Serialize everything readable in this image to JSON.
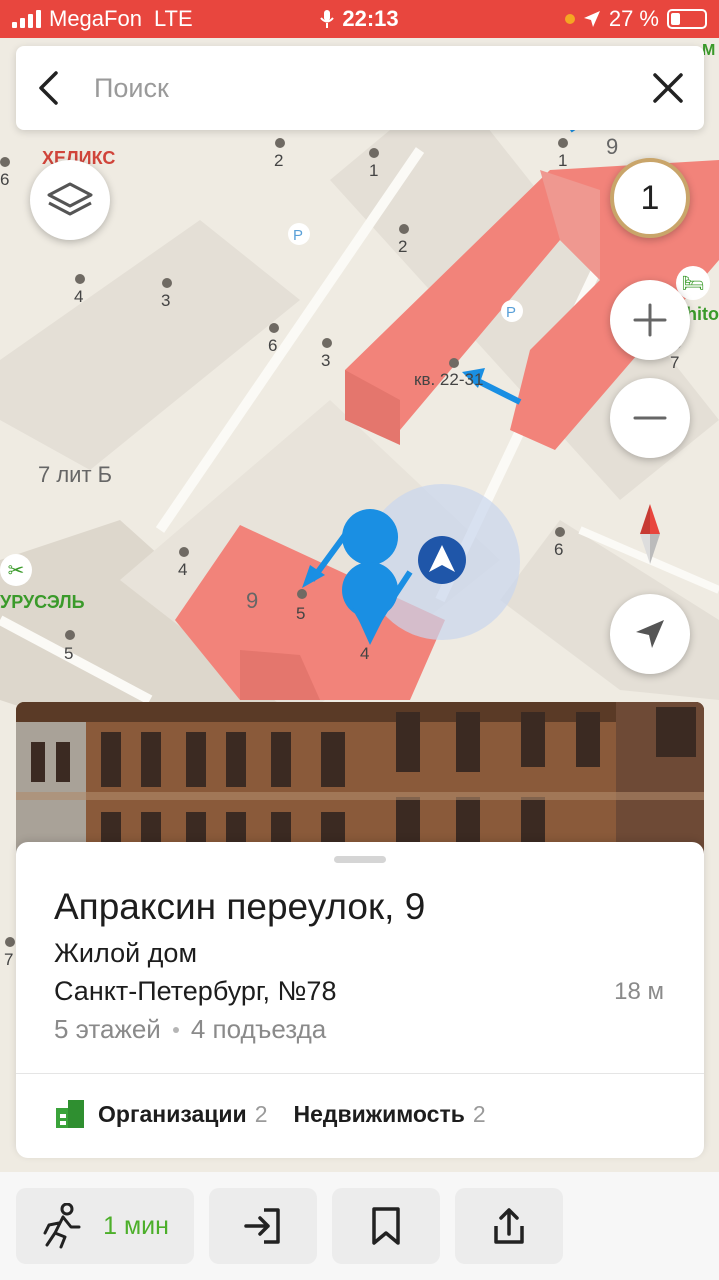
{
  "status_bar": {
    "carrier": "MegaFon",
    "network": "LTE",
    "time": "22:13",
    "battery": "27 %"
  },
  "search": {
    "placeholder": "Поиск"
  },
  "map": {
    "zoom_level": "1",
    "labels": {
      "helix": "ХЕЛИКС",
      "kv": "кв. 22-31",
      "lit": "7 лит Б",
      "urusel": "УРУСЭЛЬ",
      "hito": "hito",
      "m": "M",
      "house_9_top": "9",
      "house_9_bottom": "9"
    },
    "numbers": {
      "n1": "6",
      "n2": "2",
      "n3": "1",
      "n4": "1",
      "n5": "2",
      "n6": "4",
      "n7": "3",
      "n8": "6",
      "n9": "3",
      "n10": "7",
      "n11": "4",
      "n12": "5",
      "n13": "4",
      "n14": "6",
      "n15": "5",
      "n16": "7"
    }
  },
  "card": {
    "title": "Апраксин переулок, 9",
    "type": "Жилой дом",
    "address": "Санкт-Петербург, №78",
    "distance": "18 м",
    "floors": "5 этажей",
    "entrances": "4 подъезда",
    "organizations_label": "Организации",
    "organizations_count": "2",
    "realty_label": "Недвижимость",
    "realty_count": "2"
  },
  "bottom_bar": {
    "walk_time": "1 мин"
  },
  "colors": {
    "status_bar": "#e8463e",
    "building": "#f2837a",
    "accent_blue": "#1a8fe3",
    "walk_green": "#4caf2a"
  }
}
